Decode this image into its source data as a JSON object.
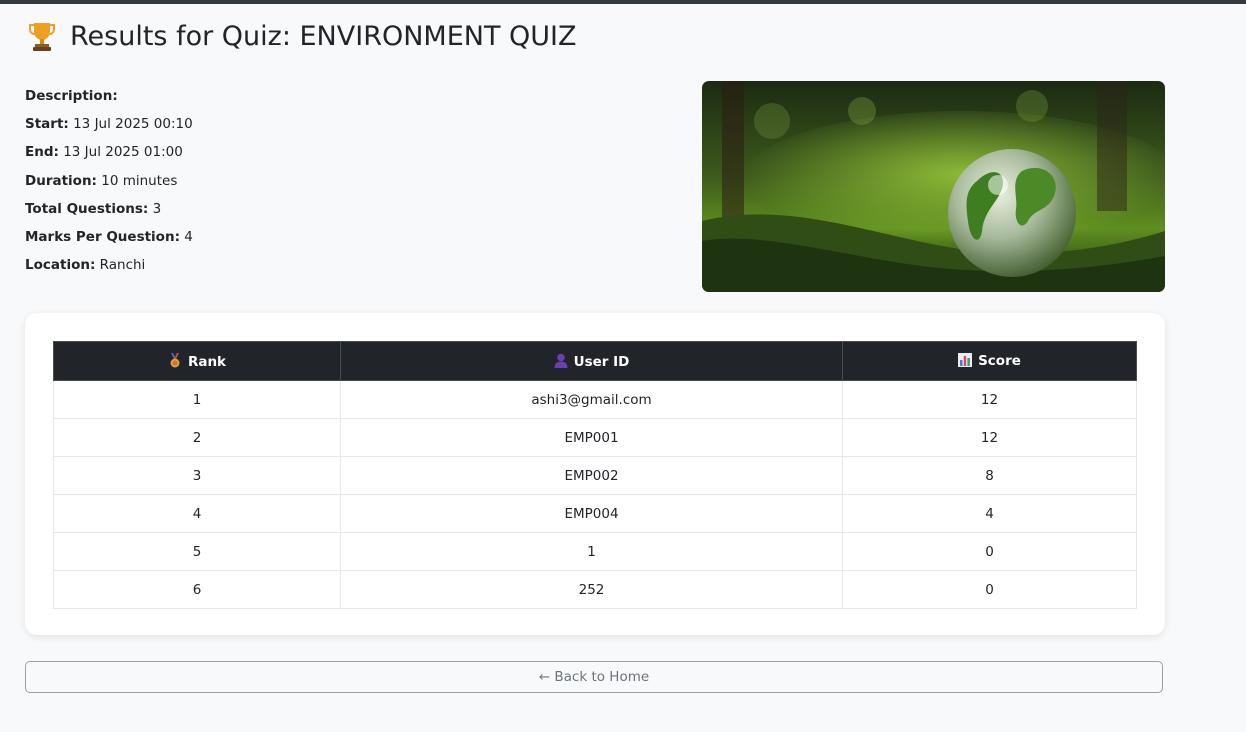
{
  "header": {
    "title": "Results for Quiz: ENVIRONMENT QUIZ",
    "icon": "trophy-icon"
  },
  "details": {
    "description_label": "Description:",
    "description_value": "",
    "start_label": "Start:",
    "start_value": "13 Jul 2025 00:10",
    "end_label": "End:",
    "end_value": "13 Jul 2025 01:00",
    "duration_label": "Duration:",
    "duration_value": "10 minutes",
    "total_questions_label": "Total Questions:",
    "total_questions_value": "3",
    "marks_label": "Marks Per Question:",
    "marks_value": "4",
    "location_label": "Location:",
    "location_value": "Ranchi"
  },
  "table": {
    "headers": {
      "rank": "Rank",
      "user_id": "User ID",
      "score": "Score"
    },
    "header_icons": [
      "medal-icon",
      "user-icon",
      "bar-chart-icon"
    ],
    "rows": [
      {
        "rank": "1",
        "user_id": "ashi3@gmail.com",
        "score": "12"
      },
      {
        "rank": "2",
        "user_id": "EMP001",
        "score": "12"
      },
      {
        "rank": "3",
        "user_id": "EMP002",
        "score": "8"
      },
      {
        "rank": "4",
        "user_id": "EMP004",
        "score": "4"
      },
      {
        "rank": "5",
        "user_id": "1",
        "score": "0"
      },
      {
        "rank": "6",
        "user_id": "252",
        "score": "0"
      }
    ]
  },
  "back_button": {
    "label": "← Back to Home"
  },
  "colors": {
    "page_bg": "#f8f9fa",
    "table_header_bg": "#212529",
    "card_bg": "#ffffff",
    "button_text": "#6c757d"
  }
}
